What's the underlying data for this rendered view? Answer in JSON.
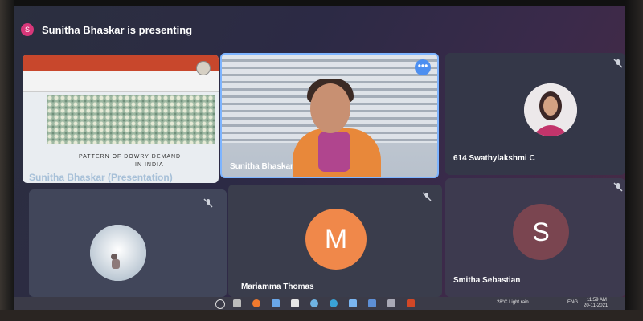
{
  "header": {
    "presenter_initial": "S",
    "presenting_text": "Sunitha Bhaskar is presenting"
  },
  "tiles": {
    "slide": {
      "title_line1": "PATTERN OF DOWRY DEMAND",
      "title_line2": "IN INDIA",
      "caption": "Sunitha Bhaskar (Presentation)"
    },
    "video": {
      "name": "Sunitha Bhaskar"
    },
    "swathy": {
      "name": "614 Swathylakshmi C"
    },
    "unnamed": {
      "name": ""
    },
    "mariamma": {
      "name": "Mariamma Thomas",
      "initial": "M",
      "color": "#f0884a"
    },
    "smitha": {
      "name": "Smitha Sebastian",
      "initial": "S",
      "color": "#7a4550"
    }
  },
  "taskbar": {
    "weather": "28°C Light rain",
    "language": "ENG",
    "time": "11:59 AM",
    "date": "20-11-2021"
  },
  "colors": {
    "accent": "#4d8ff0",
    "presenter": "#d8377a"
  }
}
